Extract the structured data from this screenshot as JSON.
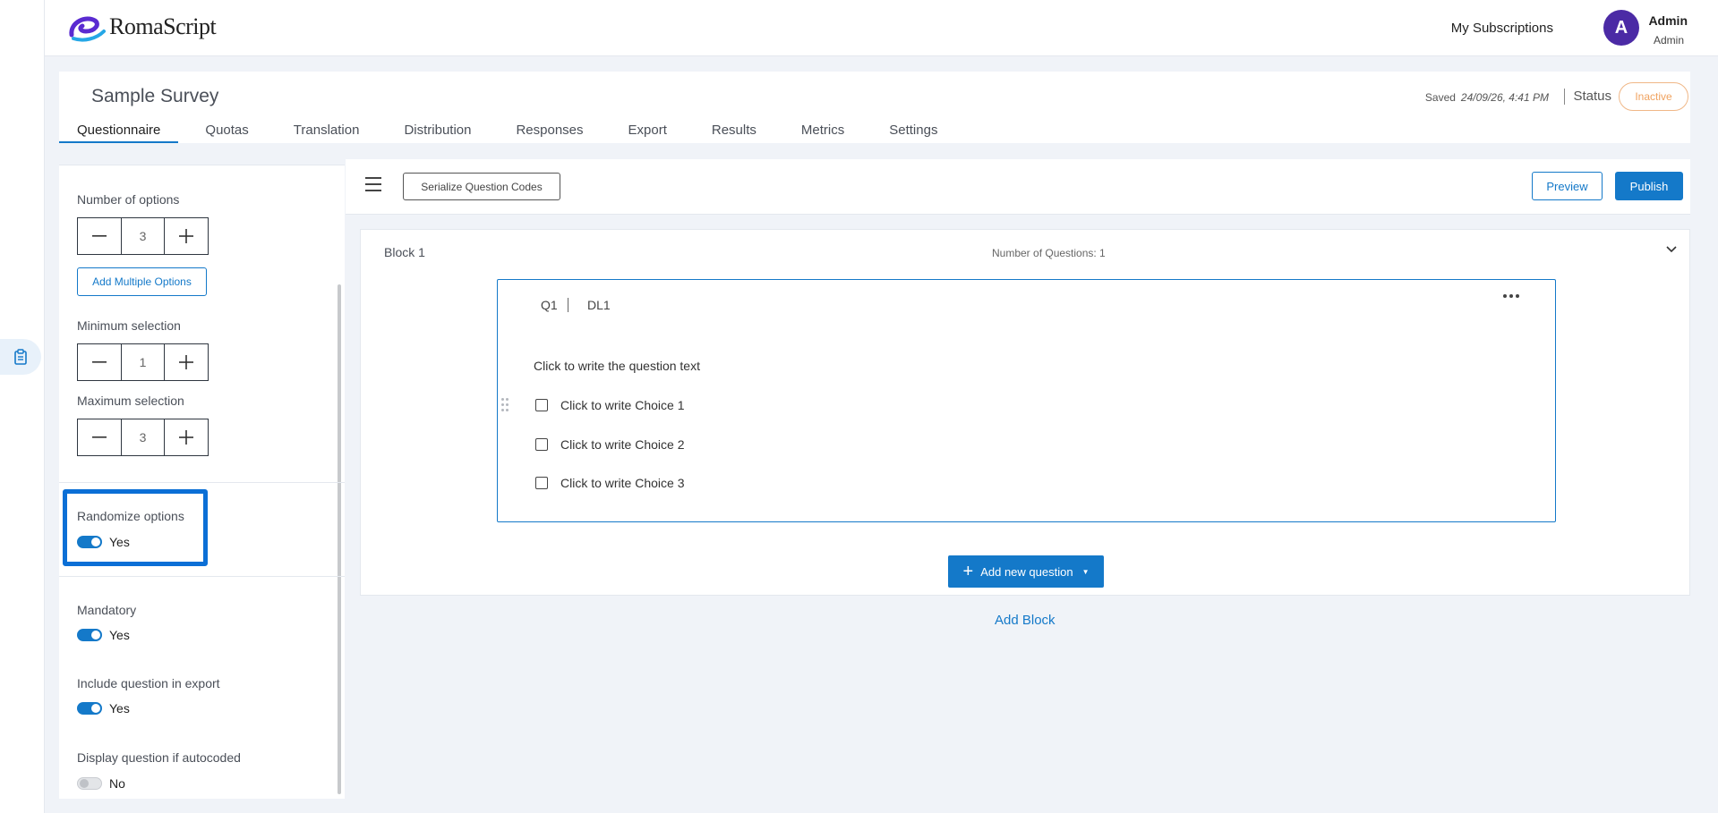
{
  "app": {
    "logo_text": "RomaScript",
    "brand_color": "#1479c9"
  },
  "header": {
    "subscriptions": "My Subscriptions",
    "avatar_initial": "A",
    "user_name": "Admin",
    "user_role": "Admin"
  },
  "survey": {
    "title": "Sample Survey",
    "saved_label": "Saved",
    "saved_time": "24/09/26, 4:41 PM",
    "status_label": "Status",
    "status_value": "Inactive"
  },
  "tabs": [
    {
      "label": "Questionnaire",
      "active": true
    },
    {
      "label": "Quotas"
    },
    {
      "label": "Translation"
    },
    {
      "label": "Distribution"
    },
    {
      "label": "Responses"
    },
    {
      "label": "Export"
    },
    {
      "label": "Results"
    },
    {
      "label": "Metrics"
    },
    {
      "label": "Settings"
    }
  ],
  "panel": {
    "num_options_label": "Number of options",
    "num_options_value": "3",
    "add_multiple_label": "Add Multiple Options",
    "min_selection_label": "Minimum selection",
    "min_selection_value": "1",
    "max_selection_label": "Maximum selection",
    "max_selection_value": "3",
    "randomize_label": "Randomize options",
    "randomize_value": "Yes",
    "mandatory_label": "Mandatory",
    "mandatory_value": "Yes",
    "include_export_label": "Include question in export",
    "include_export_value": "Yes",
    "display_autocoded_label": "Display question if autocoded",
    "display_autocoded_value": "No"
  },
  "toolbar": {
    "serialize_label": "Serialize Question Codes",
    "preview_label": "Preview",
    "publish_label": "Publish"
  },
  "block": {
    "title": "Block 1",
    "count": "Number of Questions: 1",
    "question": {
      "code": "Q1",
      "dl": "DL1",
      "text": "Click to write the question text",
      "choices": [
        "Click to write Choice 1",
        "Click to write Choice 2",
        "Click to write Choice 3"
      ]
    },
    "add_question_label": "Add new question"
  },
  "add_block_label": "Add Block"
}
